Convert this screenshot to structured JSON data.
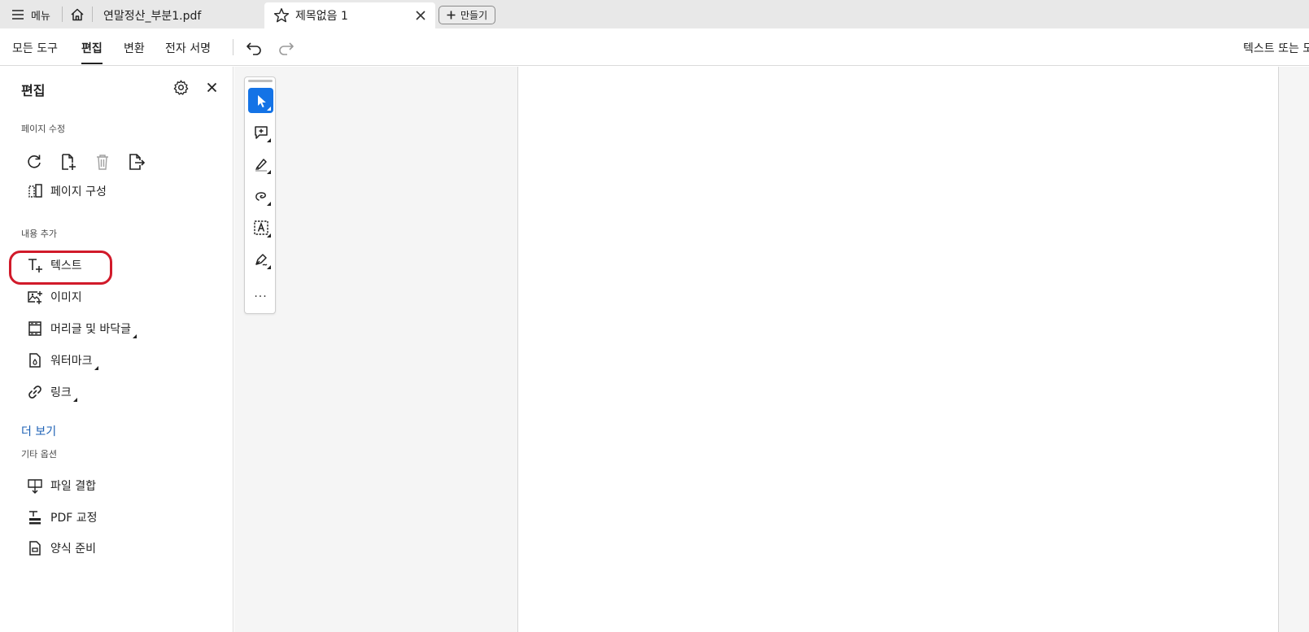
{
  "tabbar": {
    "menu_label": "메뉴",
    "file_tab": "연말정산_부분1.pdf",
    "active_tab": "제목없음 1",
    "new_button": "만들기"
  },
  "toolbar": {
    "tabs": [
      "모든 도구",
      "편집",
      "변환",
      "전자 서명"
    ],
    "active_tab": "편집",
    "search_hint": "텍스트 또는 도"
  },
  "panel": {
    "title": "편집",
    "section_page": "페이지 수정",
    "page_icons": [
      "rotate-icon",
      "insert-page-icon",
      "delete-page-icon",
      "extract-page-icon"
    ],
    "page_organize": "페이지 구성",
    "section_add": "내용 추가",
    "add_items": [
      "텍스트",
      "이미지",
      "머리글 및 바닥글",
      "워터마크",
      "링크"
    ],
    "more": "더 보기",
    "section_other": "기타 옵션",
    "other_items": [
      "파일 결합",
      "PDF 교정",
      "양식 준비"
    ]
  },
  "quick_tools": {
    "items": [
      "select-icon",
      "add-comment-icon",
      "highlight-icon",
      "draw-icon",
      "text-recognition-icon",
      "sign-icon"
    ],
    "selected": "select-icon",
    "more": "···"
  },
  "colors": {
    "accent": "#1473e6",
    "link": "#1a5fb4",
    "highlight_ring": "#d11a2a"
  }
}
